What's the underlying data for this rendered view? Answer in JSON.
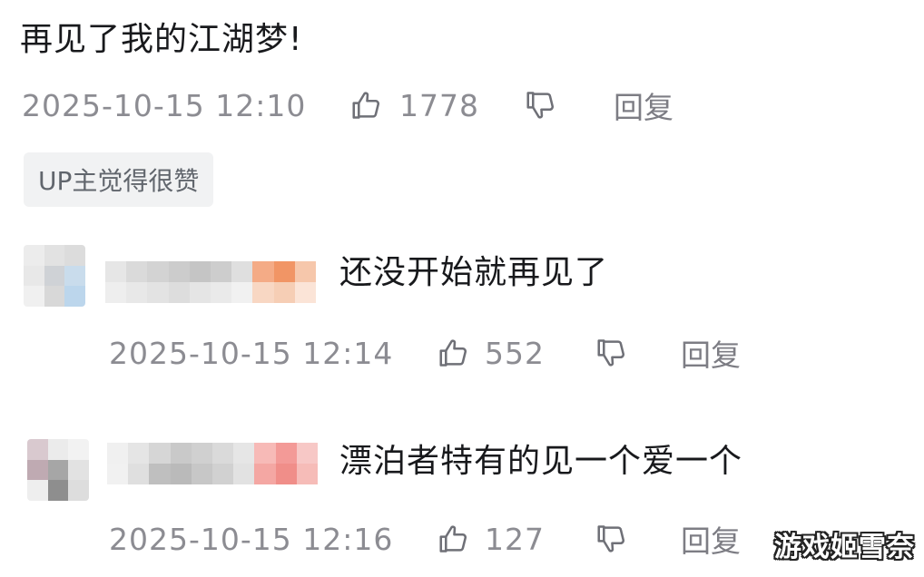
{
  "main_comment": {
    "text": "再见了我的江湖梦!",
    "time": "2025-10-15 12:10",
    "likes": "1778",
    "reply_label": "回复",
    "badge": "UP主觉得很赞"
  },
  "replies": [
    {
      "text": "还没开始就再见了",
      "time": "2025-10-15 12:14",
      "likes": "552",
      "reply_label": "回复"
    },
    {
      "text": "漂泊者特有的见一个爱一个",
      "time": "2025-10-15 12:16",
      "likes": "127",
      "reply_label": "回复"
    }
  ],
  "watermark": "游戏姬雪奈",
  "icons": {
    "like": "thumbs-up-icon",
    "dislike": "thumbs-down-icon"
  },
  "colors": {
    "text": "#18191c",
    "meta": "#8c8c92",
    "badge_bg": "#f1f2f3"
  }
}
